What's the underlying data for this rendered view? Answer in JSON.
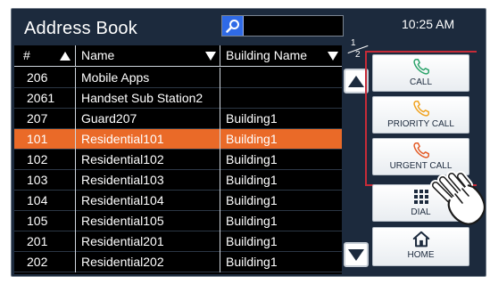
{
  "header": {
    "title": "Address Book",
    "time": "10:25 AM"
  },
  "table": {
    "columns": [
      "#",
      "Name",
      "Building Name"
    ],
    "rows": [
      {
        "num": "206",
        "name": "Mobile Apps",
        "building": ""
      },
      {
        "num": "2061",
        "name": "Handset Sub Station2",
        "building": ""
      },
      {
        "num": "207",
        "name": "Guard207",
        "building": "Building1"
      },
      {
        "num": "101",
        "name": "Residential101",
        "building": "Building1"
      },
      {
        "num": "102",
        "name": "Residential102",
        "building": "Building1"
      },
      {
        "num": "103",
        "name": "Residential103",
        "building": "Building1"
      },
      {
        "num": "104",
        "name": "Residential104",
        "building": "Building1"
      },
      {
        "num": "105",
        "name": "Residential105",
        "building": "Building1"
      },
      {
        "num": "201",
        "name": "Residential201",
        "building": "Building1"
      },
      {
        "num": "202",
        "name": "Residential202",
        "building": "Building1"
      }
    ],
    "selected_index": 3
  },
  "pager": {
    "current": "1",
    "total": "2"
  },
  "buttons": {
    "call": "CALL",
    "priority_call": "PRIORITY CALL",
    "urgent_call": "URGENT CALL",
    "dial": "DIAL",
    "home": "HOME"
  },
  "colors": {
    "background": "#1c2a3d",
    "selected_row": "#ea6a28",
    "highlight_frame": "#c62b38",
    "search_button": "#2f6ae6",
    "call_icon": "#2aa36a",
    "priority_icon": "#f0a21e",
    "urgent_icon": "#e35a25"
  },
  "icons": {
    "search": "search-icon",
    "scroll_up": "scroll-up-icon",
    "scroll_down": "scroll-down-icon",
    "call": "phone-icon",
    "dial": "keypad-icon",
    "home": "home-icon",
    "pointer": "hand-pointer-icon"
  }
}
